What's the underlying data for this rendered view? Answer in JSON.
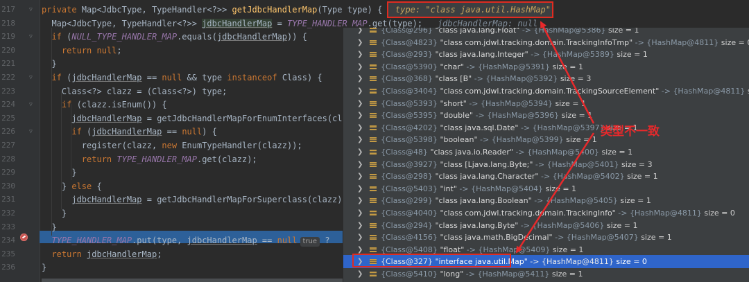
{
  "editor": {
    "line_numbers": [
      "217",
      "218",
      "219",
      "220",
      "221",
      "222",
      "223",
      "224",
      "225",
      "226",
      "227",
      "228",
      "229",
      "230",
      "231",
      "232",
      "233",
      "234",
      "235",
      "236"
    ],
    "lines": [
      {
        "s": "private",
        "a": " Map<JdbcType, TypeHandler<?>> ",
        "f": "getJdbcHandlerMap",
        "b": "(Type type) {"
      },
      {
        "a": "  Map<JdbcType, TypeHandler<?>> ",
        "v": "jdbcHandlerMap",
        "b": " = ",
        "c": "TYPE_HANDLER_MAP",
        "d": ".get(type);"
      },
      {
        "s": "  if",
        "a": " (",
        "c": "NULL_TYPE_HANDLER_MAP",
        "d": ".equals(",
        "v": "jdbcHandlerMap",
        "b": ")) {"
      },
      {
        "s": "    return null",
        "a": ";"
      },
      {
        "a": "  }"
      },
      {
        "s": "  if",
        "a": " (",
        "v": "jdbcHandlerMap",
        "b": " == ",
        "s2": "null",
        "d": " && type ",
        "s3": "instanceof",
        "e": " Class) {"
      },
      {
        "a": "    Class<?> clazz = (Class<?>) type;"
      },
      {
        "s": "    if",
        "a": " (clazz.isEnum()) {"
      },
      {
        "a": "      ",
        "v": "jdbcHandlerMap",
        "b": " = getJdbcHandlerMapForEnumInterfaces(cl"
      },
      {
        "s": "      if",
        "a": " (",
        "v": "jdbcHandlerMap",
        "b": " == ",
        "s2": "null",
        "d": ") {"
      },
      {
        "a": "        register(clazz, ",
        "s": "new",
        "b": " EnumTypeHandler(clazz));"
      },
      {
        "s": "        return",
        "a": " ",
        "c": "TYPE_HANDLER_MAP",
        "d": ".get(clazz);"
      },
      {
        "a": "      }"
      },
      {
        "a": "    } ",
        "s": "else",
        "b": " {"
      },
      {
        "a": "      ",
        "v": "jdbcHandlerMap",
        "b": " = getJdbcHandlerMapForSuperclass(clazz)"
      },
      {
        "a": "    }"
      },
      {
        "a": "  }"
      },
      {
        "c": "  TYPE_HANDLER_MAP",
        "d": ".put(type, ",
        "v": "jdbcHandlerMap",
        "b": " == ",
        "s2": "null"
      },
      {
        "s": "  return",
        "a": " ",
        "v": "jdbcHandlerMap",
        "b": ";"
      },
      {
        "a": "}"
      }
    ],
    "inline_hint_true": "true",
    "inline_hint_q": "?",
    "debug_hint": "jdbcHandlerMap: null"
  },
  "tooltip": {
    "text": "type: \"class java.util.HashMap\""
  },
  "popup": {
    "rows": [
      {
        "k": "{Class@296}",
        "s": "\"class java.lang.Float\"",
        "v": "{HashMap@5386}",
        "size": "size = 1"
      },
      {
        "k": "{Class@4823}",
        "s": "\"class com.jdwl.tracking.domain.TrackingInfoTmp\"",
        "v": "{HashMap@4811}",
        "size": "size = 0"
      },
      {
        "k": "{Class@293}",
        "s": "\"class java.lang.Integer\"",
        "v": "{HashMap@5389}",
        "size": "size = 1"
      },
      {
        "k": "{Class@5390}",
        "s": "\"char\"",
        "v": "{HashMap@5391}",
        "size": "size = 1"
      },
      {
        "k": "{Class@368}",
        "s": "\"class [B\"",
        "v": "{HashMap@5392}",
        "size": "size = 3"
      },
      {
        "k": "{Class@3404}",
        "s": "\"class com.jdwl.tracking.domain.TrackingSourceElement\"",
        "v": "{HashMap@4811}",
        "size": "size = 0"
      },
      {
        "k": "{Class@5393}",
        "s": "\"short\"",
        "v": "{HashMap@5394}",
        "size": "size = 1"
      },
      {
        "k": "{Class@5395}",
        "s": "\"double\"",
        "v": "{HashMap@5396}",
        "size": "size = 1"
      },
      {
        "k": "{Class@4202}",
        "s": "\"class java.sql.Date\"",
        "v": "{HashMap@5397}",
        "size": "size = 1"
      },
      {
        "k": "{Class@5398}",
        "s": "\"boolean\"",
        "v": "{HashMap@5399}",
        "size": "size = 1"
      },
      {
        "k": "{Class@48}",
        "s": "\"class java.io.Reader\"",
        "v": "{HashMap@5400}",
        "size": "size = 1"
      },
      {
        "k": "{Class@3927}",
        "s": "\"class [Ljava.lang.Byte;\"",
        "v": "{HashMap@5401}",
        "size": "size = 3"
      },
      {
        "k": "{Class@298}",
        "s": "\"class java.lang.Character\"",
        "v": "{HashMap@5402}",
        "size": "size = 1"
      },
      {
        "k": "{Class@5403}",
        "s": "\"int\"",
        "v": "{HashMap@5404}",
        "size": "size = 1"
      },
      {
        "k": "{Class@299}",
        "s": "\"class java.lang.Boolean\"",
        "v": "{HashMap@5405}",
        "size": "size = 1"
      },
      {
        "k": "{Class@4040}",
        "s": "\"class com.jdwl.tracking.domain.TrackingInfo\"",
        "v": "{HashMap@4811}",
        "size": "size = 0"
      },
      {
        "k": "{Class@294}",
        "s": "\"class java.lang.Byte\"",
        "v": "{HashMap@5406}",
        "size": "size = 1"
      },
      {
        "k": "{Class@4156}",
        "s": "\"class java.math.BigDecimal\"",
        "v": "{HashMap@5407}",
        "size": "size = 1"
      },
      {
        "k": "{Class@5408}",
        "s": "\"float\"",
        "v": "{HashMap@5409}",
        "size": "size = 1"
      },
      {
        "k": "{Class@327}",
        "s": "\"interface java.util.Map\"",
        "v": "{HashMap@4811}",
        "size": "size = 0",
        "selected": true
      },
      {
        "k": "{Class@5410}",
        "s": "\"long\"",
        "v": "{HashMap@5411}",
        "size": "size = 1"
      }
    ],
    "arrow": "->",
    "chevron": "❯"
  },
  "annotation": {
    "label": "类型不一致",
    "color": "#e8292b"
  }
}
